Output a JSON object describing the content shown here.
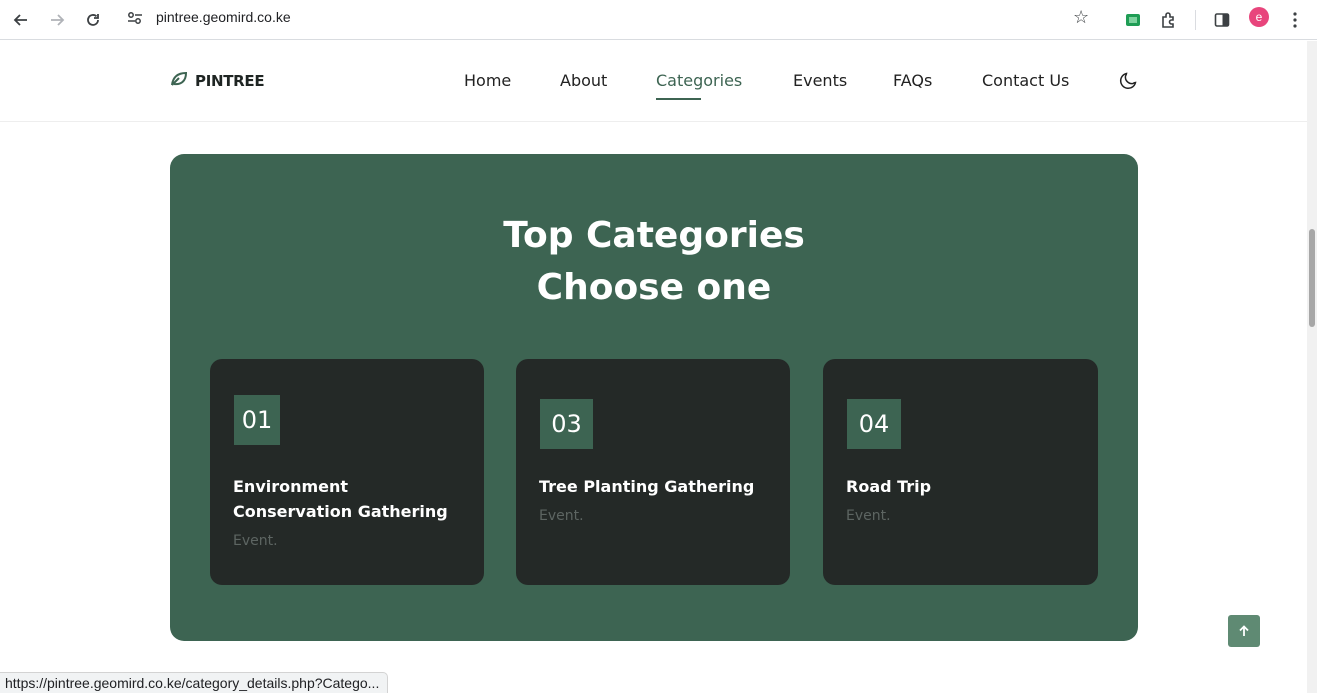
{
  "browser": {
    "url": "pintree.geomird.co.ke",
    "profile_initial": "e",
    "status_url": "https://pintree.geomird.co.ke/category_details.php?Catego..."
  },
  "header": {
    "logo_text": "PINTREE",
    "nav": [
      "Home",
      "About",
      "Categories",
      "Events",
      "FAQs",
      "Contact Us"
    ],
    "active_nav": "Categories"
  },
  "hero": {
    "title_line1": "Top Categories",
    "title_line2": "Choose one"
  },
  "categories": [
    {
      "number": "01",
      "title": "Environment Conservation Gathering",
      "subtitle": "Event."
    },
    {
      "number": "03",
      "title": "Tree Planting Gathering",
      "subtitle": "Event."
    },
    {
      "number": "04",
      "title": "Road Trip",
      "subtitle": "Event."
    }
  ],
  "colors": {
    "brand_green": "#3d6452",
    "card_dark": "#242927",
    "back_to_top": "#5f8a73"
  }
}
